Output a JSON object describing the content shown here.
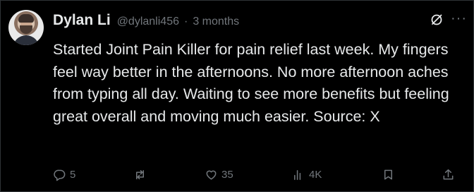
{
  "post": {
    "author": {
      "name": "Dylan Li",
      "handle": "@dylanli456",
      "separator": "·",
      "time": "3 months",
      "avatar_icon": "user-avatar"
    },
    "menu_icon": "more-icon",
    "menu_label": "···",
    "grok_icon": "grok-icon",
    "text": "Started Joint Pain Killer for pain relief last week. My fingers feel way better in the afternoons. No more afternoon aches from typing all day. Waiting to see more benefits but feeling great overall and moving much easier. Source: X",
    "actions": {
      "reply": {
        "icon": "reply-icon",
        "count": "5"
      },
      "repost": {
        "icon": "repost-icon",
        "count": ""
      },
      "like": {
        "icon": "like-icon",
        "count": "35"
      },
      "views": {
        "icon": "views-icon",
        "count": "4K"
      },
      "bookmark": {
        "icon": "bookmark-icon"
      },
      "share": {
        "icon": "share-icon"
      }
    }
  },
  "colors": {
    "background": "#000000",
    "text_primary": "#e7e9ea",
    "text_secondary": "#71767b",
    "border": "#2f3336"
  }
}
